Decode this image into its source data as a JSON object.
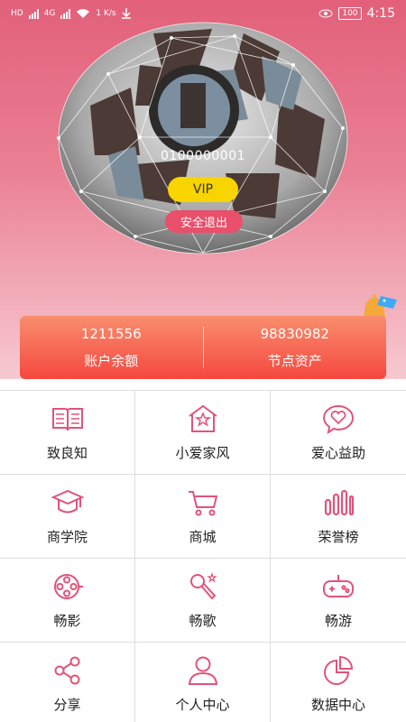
{
  "status_bar": {
    "time": "4:15",
    "battery": "100",
    "speed": "1 K/s",
    "carrier_tags": [
      "HD",
      "4G",
      "HD",
      "4G"
    ]
  },
  "profile": {
    "account_id": "0100000001",
    "vip_label": "VIP",
    "logout_label": "安全退出"
  },
  "balances": [
    {
      "value": "1211556",
      "label": "账户余额"
    },
    {
      "value": "98830982",
      "label": "节点资产"
    }
  ],
  "menu": [
    {
      "label": "致良知",
      "icon": "book-icon"
    },
    {
      "label": "小爱家风",
      "icon": "house-star-icon"
    },
    {
      "label": "爱心益助",
      "icon": "heart-chat-icon"
    },
    {
      "label": "商学院",
      "icon": "graduation-cap-icon"
    },
    {
      "label": "商城",
      "icon": "shopping-cart-icon"
    },
    {
      "label": "荣誉榜",
      "icon": "bar-ranking-icon"
    },
    {
      "label": "畅影",
      "icon": "film-reel-icon"
    },
    {
      "label": "畅歌",
      "icon": "microphone-icon"
    },
    {
      "label": "畅游",
      "icon": "gamepad-icon"
    },
    {
      "label": "分享",
      "icon": "share-icon"
    },
    {
      "label": "个人中心",
      "icon": "user-icon"
    },
    {
      "label": "数据中心",
      "icon": "pie-chart-icon"
    }
  ],
  "colors": {
    "accent": "#e8506c",
    "icon": "#e0547a",
    "vip": "#f8d400",
    "card_top": "#f98e6d",
    "card_bottom": "#f5473f"
  }
}
